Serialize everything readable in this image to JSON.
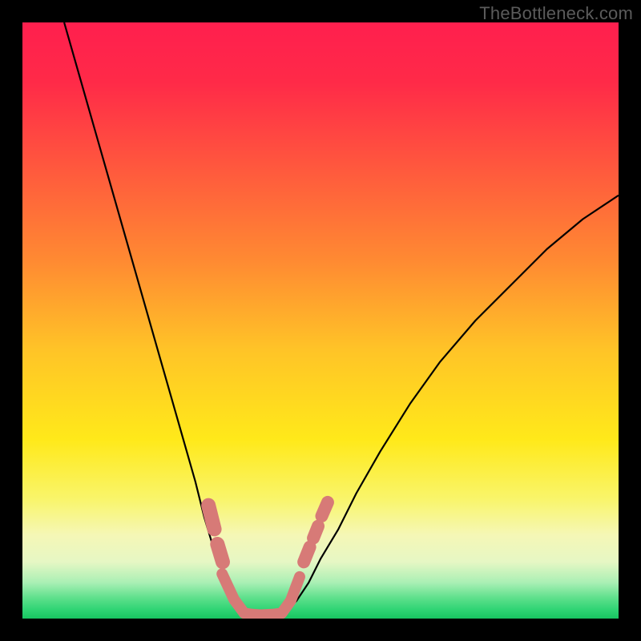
{
  "watermark": {
    "text": "TheBottleneck.com"
  },
  "chart_data": {
    "type": "line",
    "title": "",
    "xlabel": "",
    "ylabel": "",
    "xlim": [
      0,
      100
    ],
    "ylim": [
      0,
      100
    ],
    "gradient_stops": [
      {
        "offset": 0.0,
        "color": "#ff1f4e"
      },
      {
        "offset": 0.1,
        "color": "#ff2a48"
      },
      {
        "offset": 0.25,
        "color": "#ff5a3d"
      },
      {
        "offset": 0.4,
        "color": "#ff8a32"
      },
      {
        "offset": 0.55,
        "color": "#ffc427"
      },
      {
        "offset": 0.7,
        "color": "#ffe91a"
      },
      {
        "offset": 0.8,
        "color": "#f9f56b"
      },
      {
        "offset": 0.86,
        "color": "#f5f7b6"
      },
      {
        "offset": 0.905,
        "color": "#e6f7c4"
      },
      {
        "offset": 0.94,
        "color": "#a9efb4"
      },
      {
        "offset": 0.965,
        "color": "#5fe08c"
      },
      {
        "offset": 0.985,
        "color": "#2fd474"
      },
      {
        "offset": 1.0,
        "color": "#18c561"
      }
    ],
    "series": [
      {
        "name": "left-curve",
        "stroke": "#000000",
        "stroke_width": 2.2,
        "x": [
          7,
          9,
          11,
          13,
          15,
          17,
          19,
          21,
          23,
          25,
          27,
          29,
          30.5,
          32,
          33.5,
          35,
          36.2,
          37.2
        ],
        "y": [
          100,
          93,
          86,
          79,
          72,
          65,
          58,
          51,
          44,
          37,
          30,
          23,
          17,
          12,
          8,
          5,
          3,
          1.5
        ]
      },
      {
        "name": "right-curve",
        "stroke": "#000000",
        "stroke_width": 2.2,
        "x": [
          44.5,
          46,
          48,
          50,
          53,
          56,
          60,
          65,
          70,
          76,
          82,
          88,
          94,
          100
        ],
        "y": [
          1.5,
          3,
          6,
          10,
          15,
          21,
          28,
          36,
          43,
          50,
          56,
          62,
          67,
          71
        ]
      },
      {
        "name": "bottom-band",
        "stroke": "#d77a77",
        "stroke_width": 14,
        "linecap": "round",
        "x": [
          33.5,
          35.5,
          37.2,
          38.5,
          40,
          42,
          43.5,
          45,
          46.5
        ],
        "y": [
          7.5,
          3.2,
          0.9,
          0.7,
          0.6,
          0.7,
          0.9,
          3.0,
          7.0
        ]
      },
      {
        "name": "left-marker-upper",
        "type": "marker",
        "stroke": "#d77a77",
        "stroke_width": 18,
        "linecap": "round",
        "x": [
          31.2,
          32.2
        ],
        "y": [
          19,
          15
        ]
      },
      {
        "name": "left-marker-lower",
        "type": "marker",
        "stroke": "#d77a77",
        "stroke_width": 18,
        "linecap": "round",
        "x": [
          32.7,
          33.6
        ],
        "y": [
          12.5,
          9.5
        ]
      },
      {
        "name": "right-marker-a",
        "type": "marker",
        "stroke": "#d77a77",
        "stroke_width": 16,
        "linecap": "round",
        "x": [
          47.2,
          48.2
        ],
        "y": [
          9.5,
          12.0
        ]
      },
      {
        "name": "right-marker-b",
        "type": "marker",
        "stroke": "#d77a77",
        "stroke_width": 16,
        "linecap": "round",
        "x": [
          48.8,
          49.6
        ],
        "y": [
          13.5,
          15.5
        ]
      },
      {
        "name": "right-marker-c",
        "type": "marker",
        "stroke": "#d77a77",
        "stroke_width": 16,
        "linecap": "round",
        "x": [
          50.2,
          51.2
        ],
        "y": [
          17.2,
          19.5
        ]
      }
    ]
  }
}
